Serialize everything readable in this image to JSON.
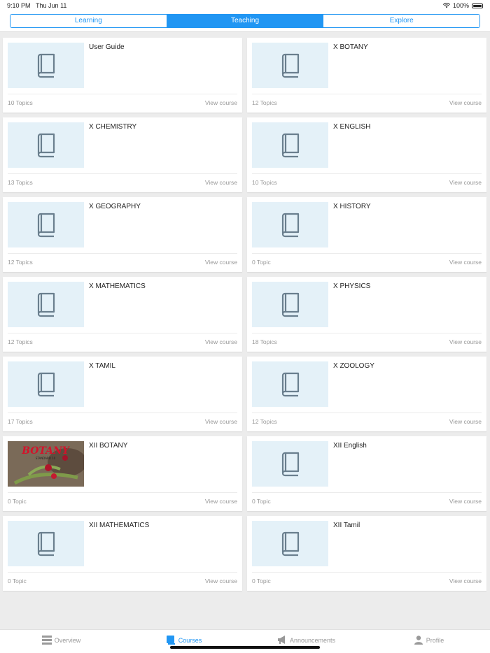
{
  "status_bar": {
    "time": "9:10 PM",
    "date": "Thu Jun 11",
    "battery": "100%"
  },
  "segmented": {
    "tabs": [
      "Learning",
      "Teaching",
      "Explore"
    ],
    "active": "Teaching"
  },
  "courses": [
    {
      "title": "User Guide",
      "topics": "10 Topics",
      "link": "View course",
      "thumb": "book-icon"
    },
    {
      "title": "X BOTANY",
      "topics": "12 Topics",
      "link": "View course",
      "thumb": "book-icon"
    },
    {
      "title": "X CHEMISTRY",
      "topics": "13 Topics",
      "link": "View course",
      "thumb": "book-icon"
    },
    {
      "title": "X ENGLISH",
      "topics": "10 Topics",
      "link": "View course",
      "thumb": "book-icon"
    },
    {
      "title": "X GEOGRAPHY",
      "topics": "12 Topics",
      "link": "View course",
      "thumb": "book-icon"
    },
    {
      "title": "X HISTORY",
      "topics": "0 Topic",
      "link": "View course",
      "thumb": "book-icon"
    },
    {
      "title": "X MATHEMATICS",
      "topics": "12 Topics",
      "link": "View course",
      "thumb": "book-icon"
    },
    {
      "title": "X PHYSICS",
      "topics": "18 Topics",
      "link": "View course",
      "thumb": "book-icon"
    },
    {
      "title": "X TAMIL",
      "topics": "17 Topics",
      "link": "View course",
      "thumb": "book-icon"
    },
    {
      "title": "X ZOOLOGY",
      "topics": "12 Topics",
      "link": "View course",
      "thumb": "book-icon"
    },
    {
      "title": "XII BOTANY",
      "topics": "0 Topic",
      "link": "View course",
      "thumb": "botany-cover-image",
      "cover_text": "BOTANY",
      "cover_subtext": "STANDARD 10"
    },
    {
      "title": "XII English",
      "topics": "0 Topic",
      "link": "View course",
      "thumb": "book-icon"
    },
    {
      "title": "XII MATHEMATICS",
      "topics": "0 Topic",
      "link": "View course",
      "thumb": "book-icon"
    },
    {
      "title": "XII Tamil",
      "topics": "0 Topic",
      "link": "View course",
      "thumb": "book-icon"
    }
  ],
  "tabbar": {
    "items": [
      {
        "label": "Overview",
        "icon": "overview-icon"
      },
      {
        "label": "Courses",
        "icon": "courses-icon"
      },
      {
        "label": "Announcements",
        "icon": "megaphone-icon"
      },
      {
        "label": "Profile",
        "icon": "profile-icon"
      }
    ],
    "active": "Courses"
  },
  "colors": {
    "accent": "#2196f3",
    "thumb_bg": "#e4f1f8",
    "page_bg": "#ececec"
  }
}
